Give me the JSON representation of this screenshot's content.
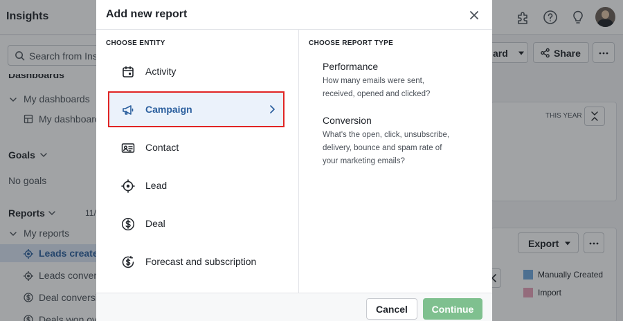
{
  "app": {
    "title": "Insights"
  },
  "sidebar": {
    "search_placeholder": "Search from Ins",
    "dashboards_heading": "Dashboards",
    "my_dashboards": "My dashboards",
    "my_dashboard_item": "My dashboard",
    "goals_heading": "Goals",
    "no_goals": "No goals",
    "reports_heading": "Reports",
    "reports_count": "11/",
    "my_reports": "My reports",
    "report_items": [
      "Leads created",
      "Leads conver",
      "Deal conversi",
      "Deals won ov"
    ]
  },
  "main": {
    "dashboard_button": "ard",
    "share_button": "Share",
    "this_year": "THIS YEAR",
    "export_button": "Export",
    "legend": [
      {
        "label": "Manually Created",
        "color": "#6fa8dc"
      },
      {
        "label": "Import",
        "color": "#e8a0b8"
      }
    ]
  },
  "modal": {
    "title": "Add new report",
    "entity_label": "CHOOSE ENTITY",
    "report_type_label": "CHOOSE REPORT TYPE",
    "entities": [
      {
        "label": "Activity",
        "icon": "calendar-icon"
      },
      {
        "label": "Campaign",
        "icon": "megaphone-icon",
        "selected": true
      },
      {
        "label": "Contact",
        "icon": "contact-card-icon"
      },
      {
        "label": "Lead",
        "icon": "target-icon"
      },
      {
        "label": "Deal",
        "icon": "dollar-icon"
      },
      {
        "label": "Forecast and subscription",
        "icon": "dollar-refresh-icon"
      }
    ],
    "report_types": [
      {
        "title": "Performance",
        "description": "How many emails were sent, received, opened and clicked?"
      },
      {
        "title": "Conversion",
        "description": "What's the open, click, unsubscribe, delivery, bounce and spam rate of your marketing emails?"
      }
    ],
    "cancel_label": "Cancel",
    "continue_label": "Continue"
  },
  "colors": {
    "accent_blue": "#2b5f9e",
    "selection_highlight": "#e02424",
    "continue_green": "#7fc08f"
  }
}
